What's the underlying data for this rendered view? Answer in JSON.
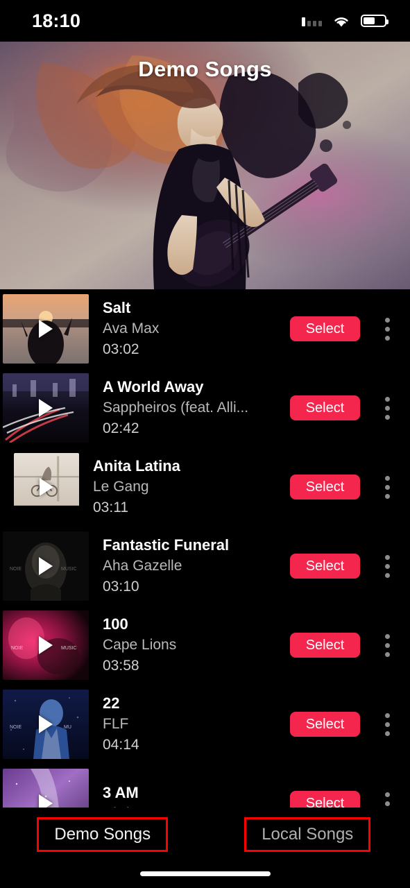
{
  "status_bar": {
    "time": "18:10",
    "signal_icon": "cellular-signal-icon",
    "wifi_icon": "wifi-icon",
    "battery_icon": "battery-icon",
    "battery_level_pct": 55
  },
  "hero": {
    "title": "Demo Songs",
    "image_name": "rock-guitarist-artwork"
  },
  "theme": {
    "accent": "#f5264e",
    "background": "#000000",
    "annotation_box": "#ff0000",
    "title_text": "#ffffff",
    "secondary_text": "#b9b9b9"
  },
  "list": {
    "select_label": "Select",
    "menu_icon": "more-vertical-icon",
    "play_icon": "play-icon",
    "songs": [
      {
        "title": "Salt",
        "artist": "Ava Max",
        "duration": "03:02",
        "thumb": "sunset-lake-silhouette"
      },
      {
        "title": "A World Away",
        "artist": "Sappheiros (feat. Alli...",
        "duration": "02:42",
        "thumb": "night-city-light-trails"
      },
      {
        "title": "Anita Latina",
        "artist": "Le Gang",
        "duration": "03:11",
        "thumb": "beige-street-cyclist"
      },
      {
        "title": "Fantastic Funeral",
        "artist": "Aha Gazelle",
        "duration": "03:10",
        "thumb": "dark-portrait-noise-music"
      },
      {
        "title": "100",
        "artist": "Cape Lions",
        "duration": "03:58",
        "thumb": "magenta-neon-scene"
      },
      {
        "title": "22",
        "artist": "FLF",
        "duration": "04:14",
        "thumb": "blue-denim-portrait"
      },
      {
        "title": "3 AM",
        "artist": "Chris Brown",
        "duration": "",
        "thumb": "purple-galaxy-nebula"
      }
    ]
  },
  "tabbar": {
    "tabs": [
      {
        "label": "Demo Songs",
        "active": true
      },
      {
        "label": "Local Songs",
        "active": false
      }
    ]
  }
}
